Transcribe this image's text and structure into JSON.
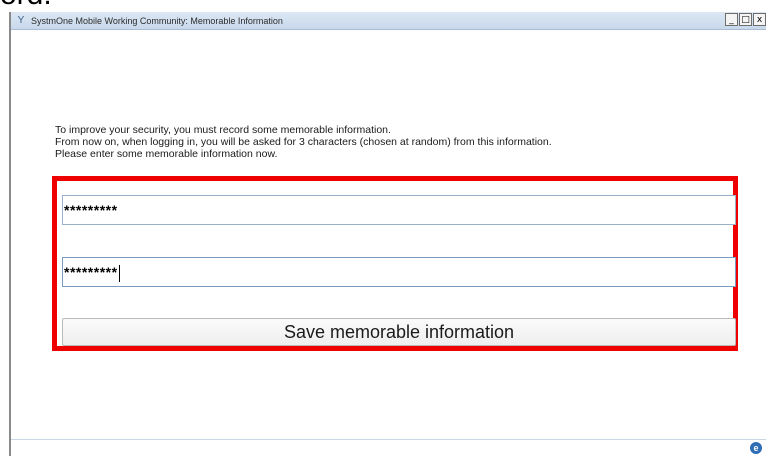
{
  "cropped_heading": "ord.",
  "window": {
    "title": "SystmOne Mobile Working Community: Memorable Information",
    "app_icon": "systmone-icon",
    "minimize": "_",
    "maximize": "□",
    "close": "x"
  },
  "instructions": [
    "To improve your security, you must record some memorable information.",
    "From now on, when logging in, you will be asked for 3 characters (chosen at random) from this information.",
    "Please enter some memorable information now."
  ],
  "fields": {
    "memorable_info": {
      "value": "*********"
    },
    "confirm_memorable_info": {
      "value": "*********"
    }
  },
  "save_button_label": "Save memorable information",
  "footer_icon": "refresh-icon",
  "colors": {
    "highlight": "#ee0000",
    "titlebar": "#dce7f3",
    "field_border": "#9ab0c9"
  }
}
